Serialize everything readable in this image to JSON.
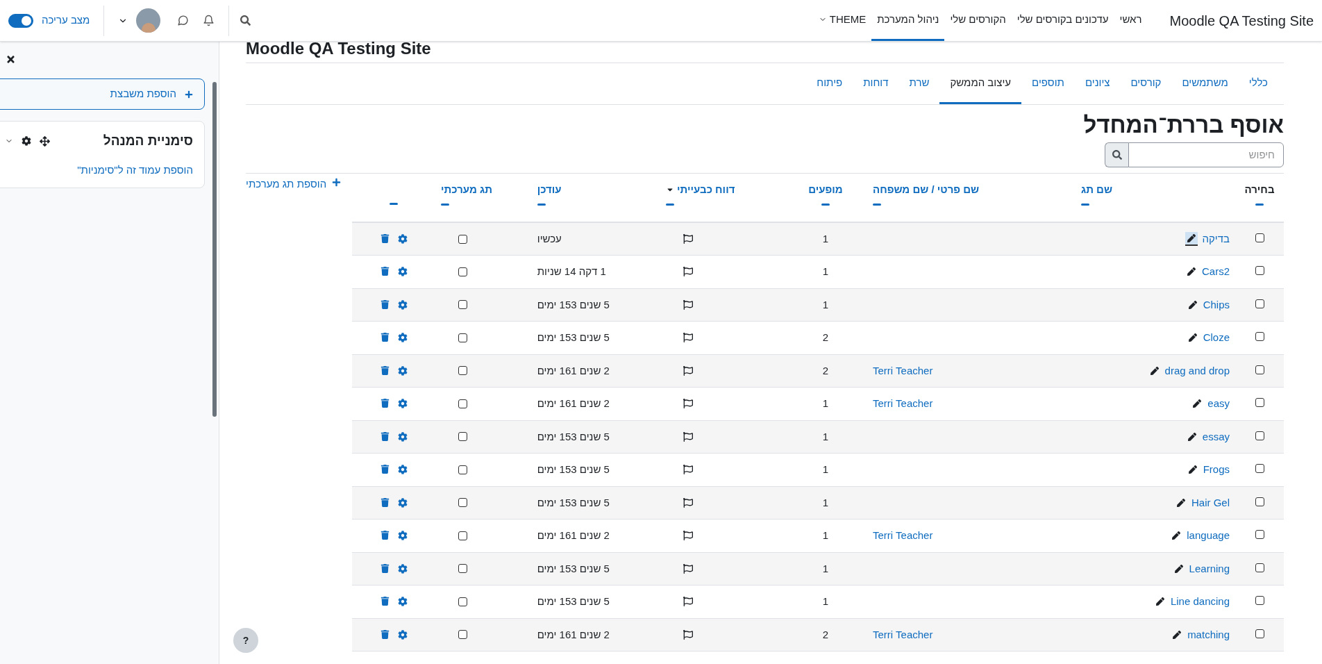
{
  "navbar": {
    "brand": "Moodle QA Testing Site",
    "items": [
      {
        "label": "ראשי",
        "selected": false,
        "caret": false
      },
      {
        "label": "עדכונים בקורסים שלי",
        "selected": false,
        "caret": false
      },
      {
        "label": "הקורסים שלי",
        "selected": false,
        "caret": false
      },
      {
        "label": "ניהול המערכת",
        "selected": true,
        "caret": false
      },
      {
        "label": "THEME",
        "selected": false,
        "caret": true
      }
    ],
    "edit_mode": {
      "label": "מצב עריכה",
      "on": true
    }
  },
  "page_heading": "Moodle QA Testing Site",
  "tabs": [
    {
      "label": "כללי",
      "selected": false
    },
    {
      "label": "משתמשים",
      "selected": false
    },
    {
      "label": "קורסים",
      "selected": false
    },
    {
      "label": "ציונים",
      "selected": false
    },
    {
      "label": "תוספים",
      "selected": false
    },
    {
      "label": "עיצוב הממשק",
      "selected": true
    },
    {
      "label": "שרת",
      "selected": false
    },
    {
      "label": "דוחות",
      "selected": false
    },
    {
      "label": "פיתוח",
      "selected": false
    }
  ],
  "title": "אוסף בררת־המחדל",
  "search": {
    "placeholder": "חיפוש"
  },
  "add_system_tag": "הוספת תג מערכתי",
  "table": {
    "columns": [
      {
        "label": "בחירה",
        "link": false,
        "sort": false
      },
      {
        "label": "שם תג",
        "link": true,
        "sort": false
      },
      {
        "label": "שם פרטי / שם משפחה",
        "link": true,
        "sort": false
      },
      {
        "label": "מופעים",
        "link": true,
        "sort": false
      },
      {
        "label": "דווח כבעייתי",
        "link": true,
        "sort": true
      },
      {
        "label": "עודכן",
        "link": true,
        "sort": false
      },
      {
        "label": "תג מערכתי",
        "link": true,
        "sort": false
      }
    ],
    "rows": [
      {
        "selected": false,
        "name": "בדיקה",
        "owner": "",
        "count": "1",
        "updated": "עכשיו",
        "system": false,
        "focused": true
      },
      {
        "selected": false,
        "name": "Cars2",
        "owner": "",
        "count": "1",
        "updated": "1 דקה 14 שניות",
        "system": false,
        "focused": false
      },
      {
        "selected": false,
        "name": "Chips",
        "owner": "",
        "count": "1",
        "updated": "5 שנים 153 ימים",
        "system": false,
        "focused": false
      },
      {
        "selected": false,
        "name": "Cloze",
        "owner": "",
        "count": "2",
        "updated": "5 שנים 153 ימים",
        "system": false,
        "focused": false
      },
      {
        "selected": false,
        "name": "drag and drop",
        "owner": "Terri Teacher",
        "count": "2",
        "updated": "2 שנים 161 ימים",
        "system": false,
        "focused": false
      },
      {
        "selected": false,
        "name": "easy",
        "owner": "Terri Teacher",
        "count": "1",
        "updated": "2 שנים 161 ימים",
        "system": false,
        "focused": false
      },
      {
        "selected": false,
        "name": "essay",
        "owner": "",
        "count": "1",
        "updated": "5 שנים 153 ימים",
        "system": false,
        "focused": false
      },
      {
        "selected": false,
        "name": "Frogs",
        "owner": "",
        "count": "1",
        "updated": "5 שנים 153 ימים",
        "system": false,
        "focused": false
      },
      {
        "selected": false,
        "name": "Hair Gel",
        "owner": "",
        "count": "1",
        "updated": "5 שנים 153 ימים",
        "system": false,
        "focused": false
      },
      {
        "selected": false,
        "name": "language",
        "owner": "Terri Teacher",
        "count": "1",
        "updated": "2 שנים 161 ימים",
        "system": false,
        "focused": false
      },
      {
        "selected": false,
        "name": "Learning",
        "owner": "",
        "count": "1",
        "updated": "5 שנים 153 ימים",
        "system": false,
        "focused": false
      },
      {
        "selected": false,
        "name": "Line dancing",
        "owner": "",
        "count": "1",
        "updated": "5 שנים 153 ימים",
        "system": false,
        "focused": false
      },
      {
        "selected": false,
        "name": "matching",
        "owner": "Terri Teacher",
        "count": "2",
        "updated": "2 שנים 161 ימים",
        "system": false,
        "focused": false
      }
    ]
  },
  "drawer": {
    "add_block": "הוספת משבצת",
    "block": {
      "title": "סימניית המנהל",
      "link": "הוספת עמוד זה ל\"סימניות\""
    }
  },
  "help": "?"
}
